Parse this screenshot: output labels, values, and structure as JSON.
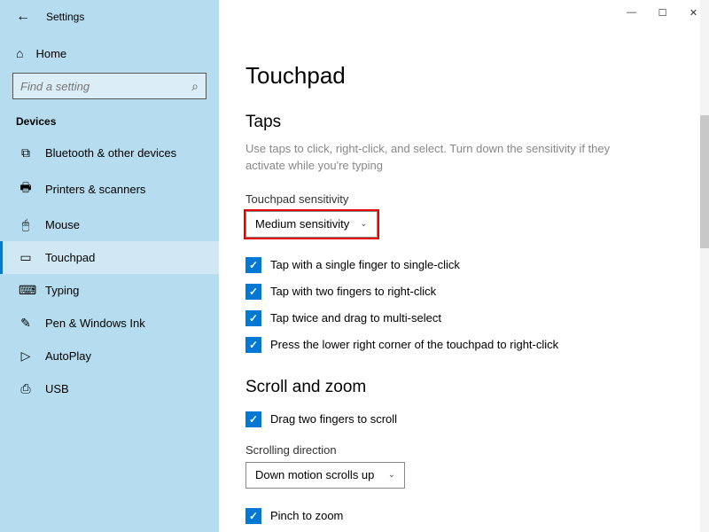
{
  "sidebar": {
    "title": "Settings",
    "home_label": "Home",
    "search_placeholder": "Find a setting",
    "section_header": "Devices",
    "items": [
      {
        "icon": "⌨",
        "label": "Bluetooth & other devices"
      },
      {
        "icon": "🖶",
        "label": "Printers & scanners"
      },
      {
        "icon": "🖱",
        "label": "Mouse"
      },
      {
        "icon": "⊟",
        "label": "Touchpad"
      },
      {
        "icon": "⌨",
        "label": "Typing"
      },
      {
        "icon": "✎",
        "label": "Pen & Windows Ink"
      },
      {
        "icon": "▶",
        "label": "AutoPlay"
      },
      {
        "icon": "🖴",
        "label": "USB"
      }
    ],
    "active_index": 3
  },
  "main": {
    "page_title": "Touchpad",
    "taps": {
      "heading": "Taps",
      "description": "Use taps to click, right-click, and select. Turn down the sensitivity if they activate while you're typing",
      "sensitivity_label": "Touchpad sensitivity",
      "sensitivity_value": "Medium sensitivity",
      "checks": [
        "Tap with a single finger to single-click",
        "Tap with two fingers to right-click",
        "Tap twice and drag to multi-select",
        "Press the lower right corner of the touchpad to right-click"
      ]
    },
    "scroll": {
      "heading": "Scroll and zoom",
      "check_drag": "Drag two fingers to scroll",
      "dir_label": "Scrolling direction",
      "dir_value": "Down motion scrolls up",
      "check_pinch": "Pinch to zoom"
    }
  }
}
